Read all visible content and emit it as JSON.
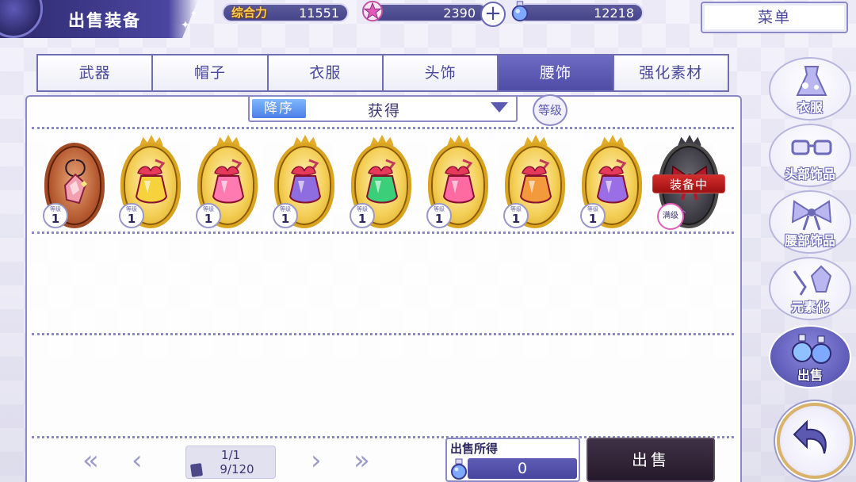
{
  "header": {
    "title": "出售装备",
    "power_label": "综合力",
    "power_value": "11551",
    "star_currency": "2390",
    "potion_currency": "12218",
    "plus_symbol": "+",
    "menu_label": "菜单"
  },
  "tabs": [
    {
      "label": "武器",
      "active": false
    },
    {
      "label": "帽子",
      "active": false
    },
    {
      "label": "衣服",
      "active": false
    },
    {
      "label": "头饰",
      "active": false
    },
    {
      "label": "腰饰",
      "active": true
    },
    {
      "label": "强化素材",
      "active": false
    }
  ],
  "sort": {
    "order_label": "降序",
    "by_value": "获得",
    "level_button": "等级"
  },
  "items": [
    {
      "frame": "bronze",
      "art": "charm-pendant-icon",
      "level_caption": "等级",
      "level": "1",
      "liquid": "#e84a6a"
    },
    {
      "frame": "gold",
      "art": "potion-bottle-icon",
      "level_caption": "等级",
      "level": "1",
      "liquid": "#f6d23c"
    },
    {
      "frame": "gold",
      "art": "potion-bottle-icon",
      "level_caption": "等级",
      "level": "1",
      "liquid": "#ff7ab0"
    },
    {
      "frame": "gold",
      "art": "potion-bottle-icon",
      "level_caption": "等级",
      "level": "1",
      "liquid": "#8e6de0"
    },
    {
      "frame": "gold",
      "art": "potion-bottle-icon",
      "level_caption": "等级",
      "level": "1",
      "liquid": "#3ccf7a"
    },
    {
      "frame": "gold",
      "art": "potion-bottle-icon",
      "level_caption": "等级",
      "level": "1",
      "liquid": "#ff6aa0"
    },
    {
      "frame": "gold",
      "art": "potion-bottle-icon",
      "level_caption": "等级",
      "level": "1",
      "liquid": "#f39a3c"
    },
    {
      "frame": "gold",
      "art": "potion-bottle-icon",
      "level_caption": "等级",
      "level": "1",
      "liquid": "#9a6ee6"
    },
    {
      "frame": "dark",
      "art": "ribbon-bow-icon",
      "equipped_label": "装备中",
      "max_label": "满级"
    }
  ],
  "pager": {
    "page": "1/1",
    "capacity": "9/120"
  },
  "footer": {
    "proceeds_label": "出售所得",
    "proceeds_value": "0",
    "sell_label": "出售"
  },
  "sidebar": [
    {
      "label": "衣服",
      "icon": "dress-icon",
      "active": false
    },
    {
      "label": "头部饰品",
      "icon": "glasses-icon",
      "active": false
    },
    {
      "label": "腰部饰品",
      "icon": "bow-icon",
      "active": false
    },
    {
      "label": "元素化",
      "icon": "crystal-icon",
      "active": false
    },
    {
      "label": "出售",
      "icon": "potions-icon",
      "active": true
    }
  ],
  "colors": {
    "accent": "#5b59b0",
    "gold_frame": "#d9a520",
    "equipped_red": "#c21f1f",
    "sell_button": "#2f2336"
  }
}
